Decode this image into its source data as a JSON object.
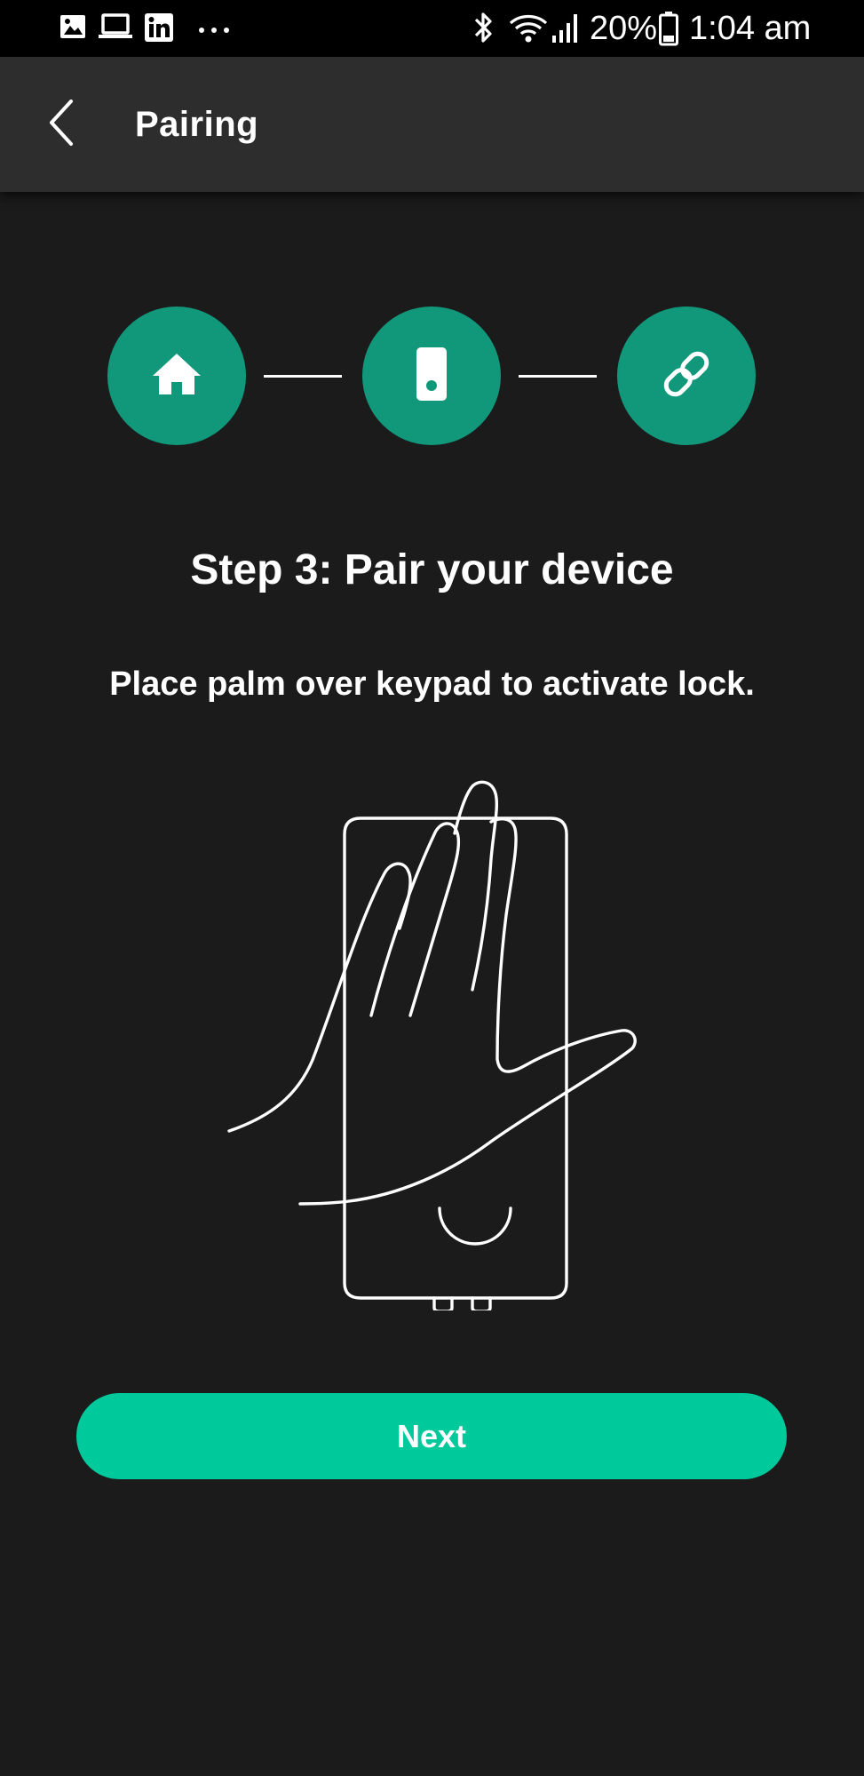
{
  "status_bar": {
    "icons": [
      "gallery-icon",
      "laptop-icon",
      "linkedin-icon",
      "more-dots-icon",
      "bluetooth-icon",
      "wifi-icon",
      "signal-icon",
      "battery-icon"
    ],
    "battery_percent": "20%",
    "time": "1:04 am"
  },
  "app_bar": {
    "title": "Pairing",
    "back_icon": "chevron-left-icon"
  },
  "stepper": {
    "steps": [
      {
        "icon": "home-icon"
      },
      {
        "icon": "lock-device-icon"
      },
      {
        "icon": "link-icon"
      }
    ],
    "current_step": 3
  },
  "content": {
    "heading": "Step 3: Pair your device",
    "instruction": "Place palm over keypad to activate lock."
  },
  "actions": {
    "next_label": "Next"
  },
  "colors": {
    "background": "#1b1b1b",
    "app_bar": "#2d2d2d",
    "step_circle": "#11987a",
    "primary_button": "#00c99b"
  }
}
